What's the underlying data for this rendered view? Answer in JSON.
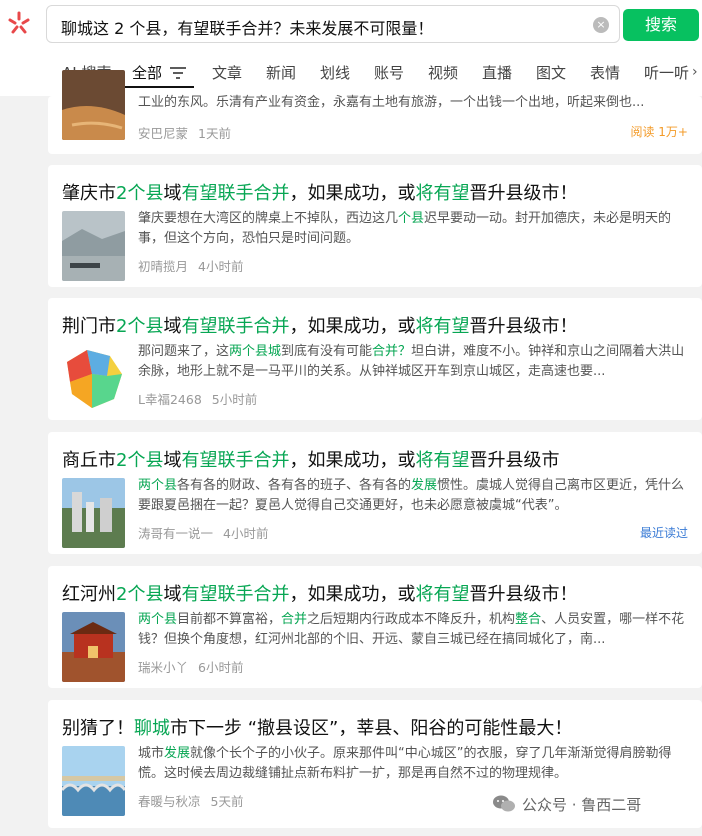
{
  "search": {
    "query": "聊城这 2 个县，有望联手合并？未来发展不可限量！",
    "clear_icon": "×",
    "button_label": "搜索"
  },
  "tabs": [
    "AI 搜索",
    "全部",
    "文章",
    "新闻",
    "划线",
    "账号",
    "视频",
    "直播",
    "图文",
    "表情",
    "听一听"
  ],
  "tabs_more_icon": "›",
  "colors": {
    "accent": "#07c160",
    "highlight": "#07a653",
    "read_orange": "#f39b29",
    "recent_blue": "#3a7bd5"
  },
  "cards": [
    {
      "title": [],
      "snippet": "工业的东风。乐清有产业有资金，永嘉有土地有旅游，一个出钱一个出地，听起来倒也...",
      "author": "安巴尼蒙",
      "time": "1天前",
      "badge": "阅读 1万+"
    },
    {
      "title": [
        {
          "t": "肇庆市",
          "h": false
        },
        {
          "t": "2个县",
          "h": true
        },
        {
          "t": "域",
          "h": false
        },
        {
          "t": "有望联手合并",
          "h": true
        },
        {
          "t": "，如果成功，或",
          "h": false
        },
        {
          "t": "将有望",
          "h": true
        },
        {
          "t": "晋升县级市！",
          "h": false
        }
      ],
      "snippet": [
        {
          "t": "肇庆要想在大湾区的牌桌上不掉队，西边这几",
          "h": false
        },
        {
          "t": "个县",
          "h": true
        },
        {
          "t": "迟早要动一动。封开加德庆，未必是明天的事，但这个方向，恐怕只是时间问题。",
          "h": false
        }
      ],
      "author": "初晴揽月",
      "time": "4小时前"
    },
    {
      "title": [
        {
          "t": "荆门市",
          "h": false
        },
        {
          "t": "2个县",
          "h": true
        },
        {
          "t": "域",
          "h": false
        },
        {
          "t": "有望联手合并",
          "h": true
        },
        {
          "t": "，如果成功，或",
          "h": false
        },
        {
          "t": "将有望",
          "h": true
        },
        {
          "t": "晋升县级市！",
          "h": false
        }
      ],
      "snippet": [
        {
          "t": "那问题来了，这",
          "h": false
        },
        {
          "t": "两个县城",
          "h": true
        },
        {
          "t": "到底有没有可能",
          "h": false
        },
        {
          "t": "合并？",
          "h": true
        },
        {
          "t": "坦白讲，难度不小。钟祥和京山之间隔着大洪山余脉，地形上就不是一马平川的关系。从钟祥城区开车到京山城区，走高速也要...",
          "h": false
        }
      ],
      "author": "L幸福2468",
      "time": "5小时前"
    },
    {
      "title": [
        {
          "t": "商丘市",
          "h": false
        },
        {
          "t": "2个县",
          "h": true
        },
        {
          "t": "域",
          "h": false
        },
        {
          "t": "有望联手合并",
          "h": true
        },
        {
          "t": "，如果成功，或",
          "h": false
        },
        {
          "t": "将有望",
          "h": true
        },
        {
          "t": "晋升县级市",
          "h": false
        }
      ],
      "snippet": [
        {
          "t": "两个县",
          "h": true
        },
        {
          "t": "各有各的财政、各有各的班子、各有各的",
          "h": false
        },
        {
          "t": "发展",
          "h": true
        },
        {
          "t": "惯性。虞城人觉得自己离市区更近，凭什么要跟夏邑捆在一起？夏邑人觉得自己交通更好，也未必愿意被虞城“代表”。",
          "h": false
        }
      ],
      "author": "涛哥有一说一",
      "time": "4小时前",
      "badge": "最近读过"
    },
    {
      "title": [
        {
          "t": "红河州",
          "h": false
        },
        {
          "t": "2个县",
          "h": true
        },
        {
          "t": "域",
          "h": false
        },
        {
          "t": "有望联手合并",
          "h": true
        },
        {
          "t": "，如果成功，或",
          "h": false
        },
        {
          "t": "将有望",
          "h": true
        },
        {
          "t": "晋升县级市！",
          "h": false
        }
      ],
      "snippet": [
        {
          "t": "两个县",
          "h": true
        },
        {
          "t": "目前都不算富裕，",
          "h": false
        },
        {
          "t": "合并",
          "h": true
        },
        {
          "t": "之后短期内行政成本不降反升，机构",
          "h": false
        },
        {
          "t": "整合",
          "h": true
        },
        {
          "t": "、人员安置，哪一样不花钱？但换个角度想，红河州北部的个旧、开远、蒙自三城已经在搞同城化了，南...",
          "h": false
        }
      ],
      "author": "瑞米小丫",
      "time": "6小时前"
    },
    {
      "title": [
        {
          "t": "别猜了！",
          "h": false
        },
        {
          "t": "聊城",
          "h": true
        },
        {
          "t": "市下一步 “撤县设区”，莘县、阳谷的可能性最大！",
          "h": false
        }
      ],
      "snippet": [
        {
          "t": "城市",
          "h": false
        },
        {
          "t": "发展",
          "h": true
        },
        {
          "t": "就像个长个子的小伙子。原来那件叫“中心城区”的衣服，穿了几年渐渐觉得肩膀勒得慌。这时候去周边裁缝铺扯点新布料扩一扩，那是再自然不过的物理规律。",
          "h": false
        }
      ],
      "author": "春暖与秋凉",
      "time": "5天前"
    }
  ],
  "watermark": {
    "icon": "wechat-icon",
    "text": "公众号 · 鲁西二哥"
  }
}
